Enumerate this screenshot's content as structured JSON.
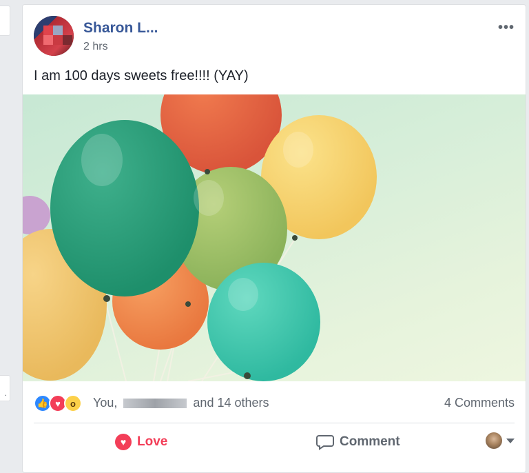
{
  "post": {
    "author": "Sharon L...",
    "time": "2 hrs",
    "message": "I am 100 days sweets free!!!! (YAY)",
    "more_icon": "ellipsis-icon"
  },
  "reactions": {
    "icons": [
      "like-reaction-icon",
      "love-reaction-icon",
      "wow-reaction-icon"
    ],
    "names_prefix": "You,",
    "names_suffix": "and 14 others",
    "comments": "4 Comments"
  },
  "actions": {
    "love_label": "Love",
    "comment_label": "Comment"
  },
  "colors": {
    "link": "#385898",
    "love": "#f33e58",
    "like": "#2d88ff",
    "wow": "#fcd049"
  }
}
